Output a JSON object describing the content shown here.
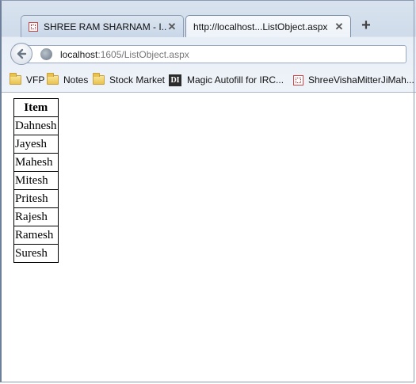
{
  "browser": {
    "tabs": [
      {
        "title": "SHREE RAM SHARNAM - I...",
        "active": false
      },
      {
        "title": "http://localhost...ListObject.aspx",
        "active": true
      }
    ],
    "close_glyph": "✕",
    "new_tab_glyph": "+",
    "url": {
      "host": "localhost",
      "path": ":1605/ListObject.aspx"
    },
    "bookmarks": [
      {
        "label": "VFP",
        "icon": "folder-icon"
      },
      {
        "label": "Notes",
        "icon": "folder-icon"
      },
      {
        "label": "Stock Market",
        "icon": "folder-icon"
      },
      {
        "label": "Magic Autofill for IRC...",
        "icon": "di-icon",
        "icon_text": "DI"
      },
      {
        "label": "ShreeVishaMitterJiMah...",
        "icon": "site-favicon"
      }
    ]
  },
  "table": {
    "header": "Item",
    "rows": [
      "Dahnesh",
      "Jayesh",
      "Mahesh",
      "Mitesh",
      "Pritesh",
      "Rajesh",
      "Ramesh",
      "Suresh"
    ]
  },
  "colors": {
    "chrome": "#cfdbea",
    "tab_border": "#8e9db4",
    "folder": "#e9c24e"
  }
}
